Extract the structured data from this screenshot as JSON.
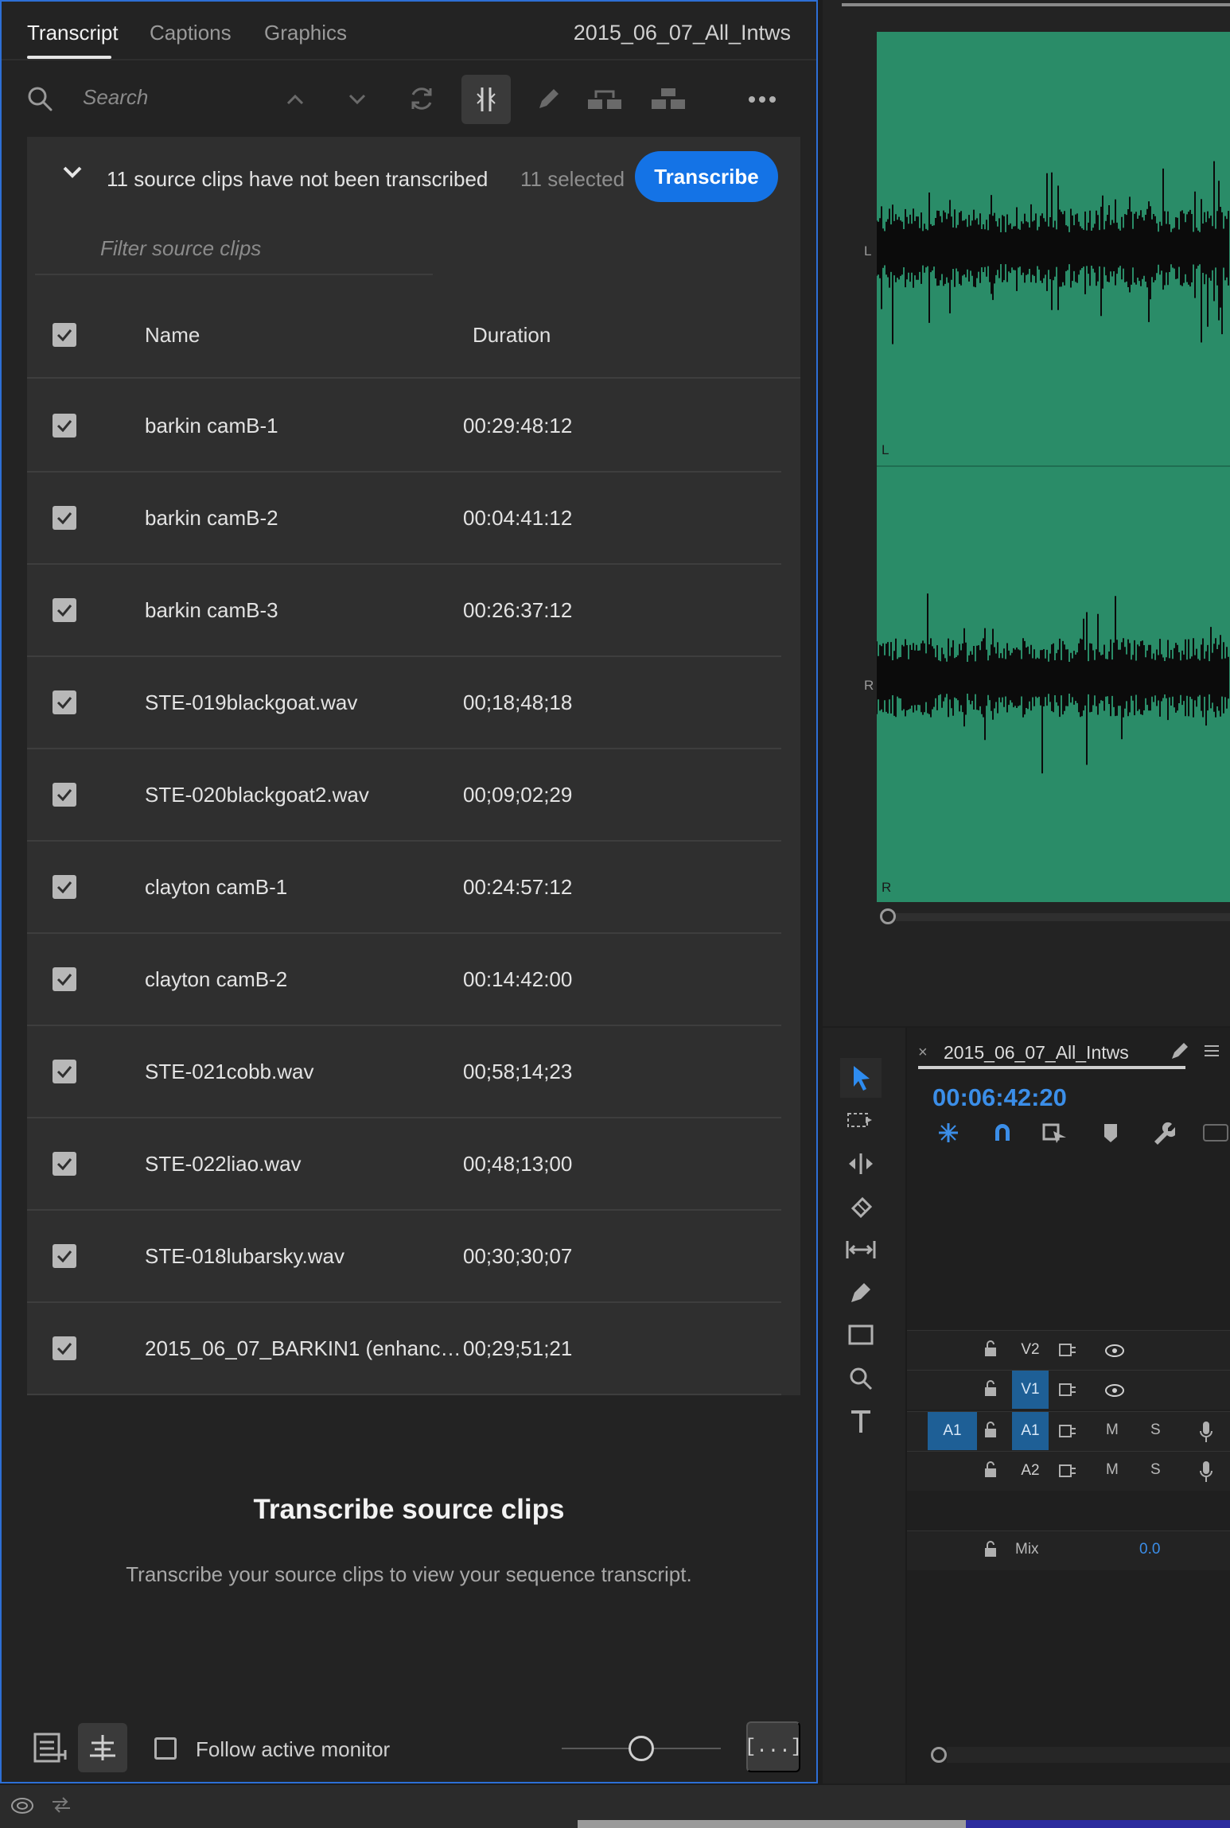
{
  "tabs": [
    {
      "label": "Transcript",
      "active": true
    },
    {
      "label": "Captions",
      "active": false
    },
    {
      "label": "Graphics",
      "active": false
    }
  ],
  "sequence_name": "2015_06_07_All_Intws",
  "search": {
    "placeholder": "Search"
  },
  "toolbar_icons": [
    "search-icon",
    "chevron-up-icon",
    "chevron-down-icon",
    "refresh-icon",
    "split-icon",
    "pencil-icon",
    "merge-segments-icon",
    "split-segments-icon",
    "more-icon"
  ],
  "clips_header": {
    "message": "11 source clips have not been transcribed",
    "selected": "11 selected",
    "transcribe_label": "Transcribe",
    "filter_placeholder": "Filter source clips"
  },
  "table": {
    "columns": [
      "Name",
      "Duration"
    ],
    "rows": [
      {
        "name": "barkin camB-1",
        "duration": "00:29:48:12",
        "checked": true
      },
      {
        "name": "barkin camB-2",
        "duration": "00:04:41:12",
        "checked": true
      },
      {
        "name": "barkin camB-3",
        "duration": "00:26:37:12",
        "checked": true
      },
      {
        "name": "STE-019blackgoat.wav",
        "duration": "00;18;48;18",
        "checked": true
      },
      {
        "name": "STE-020blackgoat2.wav",
        "duration": "00;09;02;29",
        "checked": true
      },
      {
        "name": "clayton camB-1",
        "duration": "00:24:57:12",
        "checked": true
      },
      {
        "name": "clayton camB-2",
        "duration": "00:14:42:00",
        "checked": true
      },
      {
        "name": "STE-021cobb.wav",
        "duration": "00;58;14;23",
        "checked": true
      },
      {
        "name": "STE-022liao.wav",
        "duration": "00;48;13;00",
        "checked": true
      },
      {
        "name": "STE-018lubarsky.wav",
        "duration": "00;30;30;07",
        "checked": true
      },
      {
        "name": "2015_06_07_BARKIN1 (enhanced)...",
        "duration": "00;29;51;21",
        "checked": true
      }
    ]
  },
  "empty_state": {
    "title": "Transcribe source clips",
    "subtitle": "Transcribe your source clips to view your sequence transcript."
  },
  "footer": {
    "follow_label": "Follow active monitor",
    "follow_checked": false,
    "ellipsis_label": "[...]"
  },
  "waveform": {
    "channels": [
      "L",
      "R"
    ],
    "color": "#2a8c68"
  },
  "timeline": {
    "tab_title": "2015_06_07_All_Intws",
    "close_label": "×",
    "playhead": "00:06:42:20",
    "tracks": [
      {
        "source": "",
        "target": "V2",
        "target_active": false,
        "m": "",
        "s": ""
      },
      {
        "source": "",
        "target": "V1",
        "target_active": true,
        "m": "",
        "s": ""
      },
      {
        "source": "A1",
        "target": "A1",
        "target_active": true,
        "m": "M",
        "s": "S"
      },
      {
        "source": "",
        "target": "A2",
        "target_active": false,
        "m": "M",
        "s": "S"
      }
    ],
    "mix_label": "Mix",
    "mix_value": "0.0"
  },
  "colors": {
    "accent": "#1473e6",
    "timecode": "#3b8ee8",
    "track_target": "#1e5f96"
  }
}
